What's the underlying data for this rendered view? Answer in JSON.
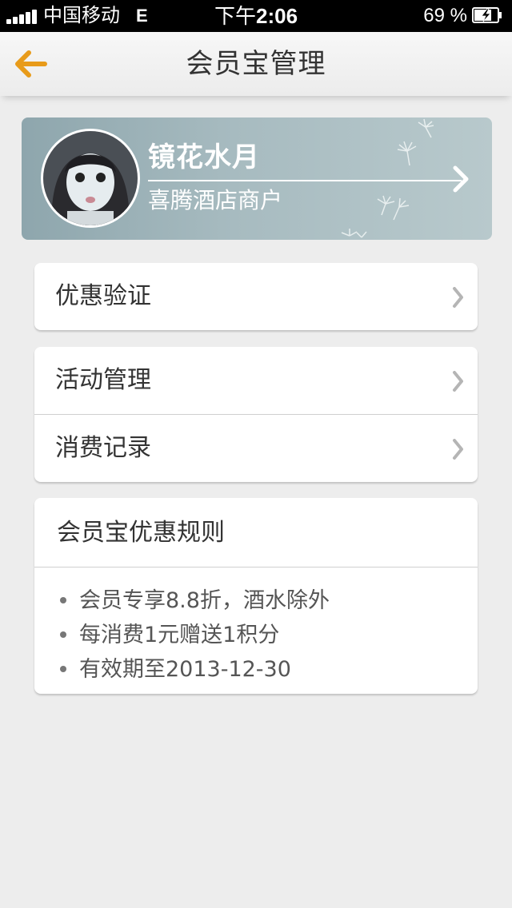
{
  "status_bar": {
    "carrier": "中国移动",
    "network": "E",
    "time_prefix": "下午",
    "time": "2:06",
    "battery": "69 %"
  },
  "nav": {
    "back_icon": "back-arrow-icon",
    "title": "会员宝管理",
    "accent_color": "#e89b1a"
  },
  "profile": {
    "name": "镜花水月",
    "merchant": "喜腾酒店商户"
  },
  "menu_groups": [
    {
      "items": [
        {
          "label": "优惠验证"
        }
      ]
    },
    {
      "items": [
        {
          "label": "活动管理"
        },
        {
          "label": "消费记录"
        }
      ]
    }
  ],
  "rules": {
    "title": "会员宝优惠规则",
    "items": [
      "会员专享8.8折，酒水除外",
      "每消费1元赠送1积分",
      "有效期至2013-12-30"
    ]
  }
}
